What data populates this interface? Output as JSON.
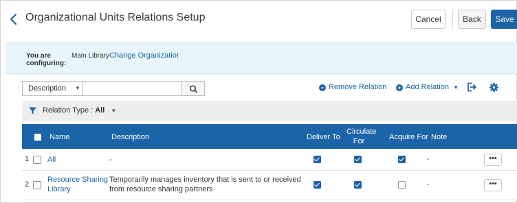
{
  "header": {
    "title": "Organizational Units Relations Setup",
    "cancel_label": "Cancel",
    "back_label": "Back",
    "save_label": "Save"
  },
  "banner": {
    "you_are_line1": "You are",
    "you_are_line2": "configuring:",
    "library": "Main Library",
    "change_link": "Change Organization Unit"
  },
  "toolbar": {
    "search_field": "Description",
    "search_value": "",
    "remove_label": "Remove Relation",
    "add_label": "Add Relation",
    "export_icon": "export-icon",
    "settings_icon": "gear-icon"
  },
  "filter": {
    "label": "Relation Type :",
    "value": "All"
  },
  "table": {
    "columns": {
      "name": "Name",
      "description": "Description",
      "deliver_to": "Deliver To",
      "circulate_for_1": "Circulate",
      "circulate_for_2": "For",
      "acquire_for": "Acquire For",
      "note": "Note"
    },
    "rows": [
      {
        "num": "1",
        "name_1": "All",
        "name_2": "",
        "description_1": "-",
        "description_2": "",
        "deliver_to": true,
        "circulate_for": true,
        "acquire_for": true,
        "note": "-",
        "more": "•••"
      },
      {
        "num": "2",
        "name_1": "Resource Sharing",
        "name_2": "Library",
        "description_1": "Temporarily manages inventory that is sent to or received",
        "description_2": "from resource sharing partners",
        "deliver_to": true,
        "circulate_for": true,
        "acquire_for": false,
        "note": "-",
        "more": "•••"
      }
    ]
  },
  "colors": {
    "accent": "#1c64a8",
    "banner_bg": "#e8f6fb",
    "filter_bg": "#eeeeee"
  }
}
